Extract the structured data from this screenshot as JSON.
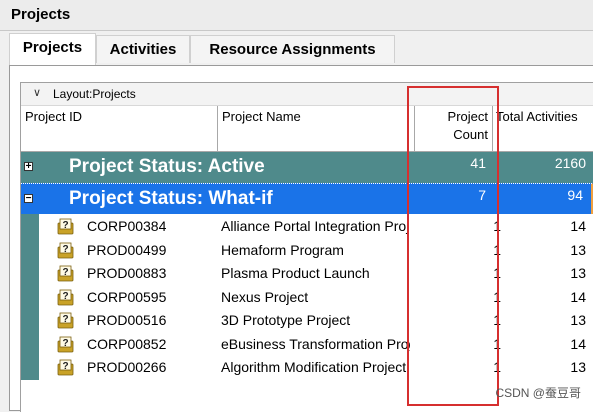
{
  "window": {
    "title": "Projects"
  },
  "tabs": [
    {
      "label": "Projects"
    },
    {
      "label": "Activities"
    },
    {
      "label": "Resource Assignments"
    }
  ],
  "layout": {
    "label": "Layout:Projects"
  },
  "columns": {
    "project_id": "Project ID",
    "project_name": "Project Name",
    "project_count_line1": "Project",
    "project_count_line2": "Count",
    "total_activities": "Total Activities"
  },
  "groups": [
    {
      "label": "Project Status: Active",
      "expander": "+",
      "project_count": "41",
      "total_activities": "2160"
    },
    {
      "label": "Project Status: What-if",
      "expander": "−",
      "project_count": "7",
      "total_activities": "94"
    }
  ],
  "rows": [
    {
      "id": "CORP00384",
      "name": "Alliance Portal Integration Proj",
      "count": "1",
      "activities": "14"
    },
    {
      "id": "PROD00499",
      "name": "Hemaform Program",
      "count": "1",
      "activities": "13"
    },
    {
      "id": "PROD00883",
      "name": "Plasma Product Launch",
      "count": "1",
      "activities": "13"
    },
    {
      "id": "CORP00595",
      "name": "Nexus Project",
      "count": "1",
      "activities": "14"
    },
    {
      "id": "PROD00516",
      "name": "3D Prototype Project",
      "count": "1",
      "activities": "13"
    },
    {
      "id": "CORP00852",
      "name": "eBusiness Transformation Prog",
      "count": "1",
      "activities": "14"
    },
    {
      "id": "PROD00266",
      "name": "Algorithm Modification Project",
      "count": "1",
      "activities": "13"
    }
  ],
  "icons": {
    "project_row": "what-if-project-icon"
  },
  "colors": {
    "group_active": "#4f8a8b",
    "group_selected": "#1a73e8",
    "highlight_box": "#d62f2f"
  },
  "watermark": "CSDN @蚕豆哥"
}
